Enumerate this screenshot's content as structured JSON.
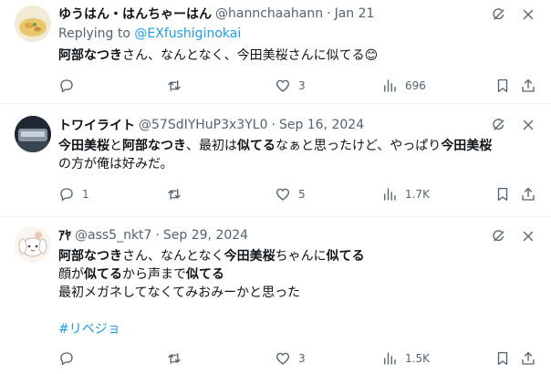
{
  "tweets": [
    {
      "name": "ゆうはん・はんちゃーはん",
      "handle": "@hannchaahann",
      "dot": "·",
      "date": "Jan 21",
      "replying_prefix": "Replying to ",
      "replying_to": "@EXfushiginokai",
      "body": [
        [
          {
            "t": "阿部なつき",
            "b": true
          },
          {
            "t": "さん、なんとなく、今田美桜さんに似てる"
          },
          {
            "t": "😊"
          }
        ]
      ],
      "reply_count": "",
      "retweet_count": "",
      "like_count": "3",
      "view_count": "696"
    },
    {
      "name": "トワイライト",
      "handle": "@57SdIYHuP3x3YL0",
      "dot": "·",
      "date": "Sep 16, 2024",
      "body": [
        [
          {
            "t": "今田美桜",
            "b": true
          },
          {
            "t": "と"
          },
          {
            "t": "阿部なつき",
            "b": true
          },
          {
            "t": "、最初は"
          },
          {
            "t": "似てる",
            "b": true
          },
          {
            "t": "なぁと思ったけど、やっぱり"
          },
          {
            "t": "今田美桜",
            "b": true
          }
        ],
        [
          {
            "t": "の方が俺は好みだ。"
          }
        ]
      ],
      "reply_count": "1",
      "retweet_count": "",
      "like_count": "5",
      "view_count": "1.7K"
    },
    {
      "name": "ｱﾔ",
      "handle": "@ass5_nkt7",
      "dot": "·",
      "date": "Sep 29, 2024",
      "body": [
        [
          {
            "t": "阿部なつき",
            "b": true
          },
          {
            "t": "さん、なんとなく"
          },
          {
            "t": "今田美桜",
            "b": true
          },
          {
            "t": "ちゃんに"
          },
          {
            "t": "似てる",
            "b": true
          }
        ],
        [
          {
            "t": "顔が"
          },
          {
            "t": "似てる",
            "b": true
          },
          {
            "t": "から声まで"
          },
          {
            "t": "似てる",
            "b": true
          }
        ],
        [
          {
            "t": "最初メガネしてなくてみおみーかと思った"
          }
        ],
        [
          {
            "t": ""
          }
        ],
        [
          {
            "t": "#リベジョ",
            "h": true
          }
        ]
      ],
      "reply_count": "",
      "retweet_count": "",
      "like_count": "3",
      "view_count": "1.5K"
    }
  ],
  "icons": {
    "top": [
      "grok-icon",
      "more-icon"
    ],
    "actions": [
      "reply-icon",
      "retweet-icon",
      "like-icon",
      "views-icon",
      "bookmark-icon",
      "share-icon"
    ]
  },
  "colors": {
    "text": "#0f1419",
    "muted": "#536471",
    "link": "#1d9bf0",
    "divider": "#eff3f4"
  }
}
